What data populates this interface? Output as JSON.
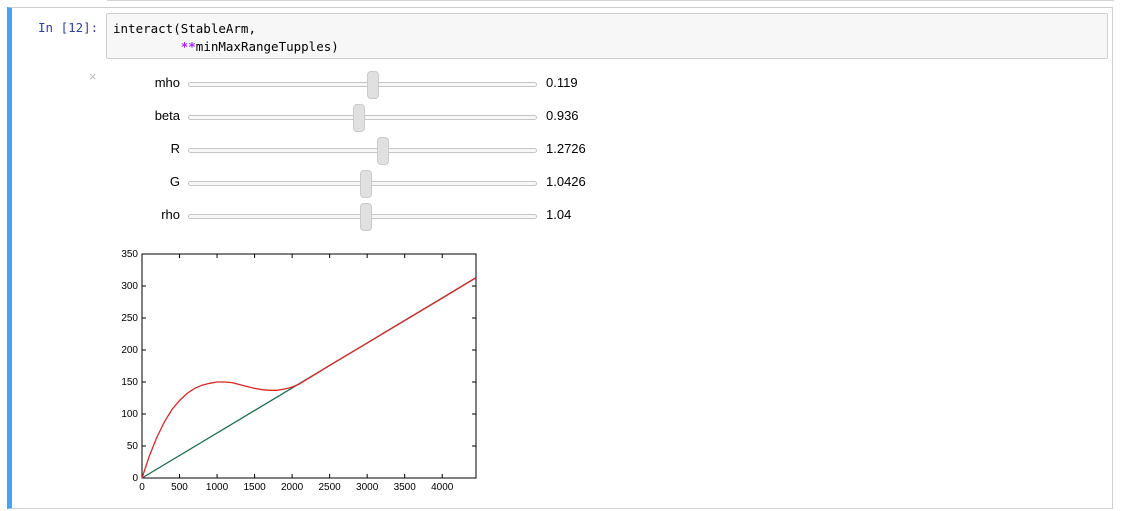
{
  "cell": {
    "prompt": "In [12]:",
    "code_line1": "interact(StableArm,",
    "code_line2_indent": "         ",
    "code_line2_op": "**",
    "code_line2_rest": "minMaxRangeTupples)",
    "close_glyph": "×"
  },
  "sliders": [
    {
      "label": "mho",
      "value_text": "0.119",
      "fraction": 0.53
    },
    {
      "label": "beta",
      "value_text": "0.936",
      "fraction": 0.49
    },
    {
      "label": "R",
      "value_text": "1.2726",
      "fraction": 0.56
    },
    {
      "label": "G",
      "value_text": "1.0426",
      "fraction": 0.51
    },
    {
      "label": "rho",
      "value_text": "1.04",
      "fraction": 0.51
    }
  ],
  "chart_data": {
    "type": "line",
    "xlim": [
      0,
      4450
    ],
    "ylim": [
      0,
      350
    ],
    "xticks": [
      0,
      500,
      1000,
      1500,
      2000,
      2500,
      3000,
      3500,
      4000
    ],
    "yticks": [
      0,
      50,
      100,
      150,
      200,
      250,
      300,
      350
    ],
    "grid": false,
    "colors": {
      "red": "#d62728",
      "green": "#1a6b4a"
    },
    "series": [
      {
        "color": "#1a6b4a",
        "x": [
          0,
          4450
        ],
        "y": [
          0,
          313
        ]
      },
      {
        "color": "#d62728",
        "x": [
          0,
          100,
          200,
          300,
          400,
          500,
          600,
          700,
          800,
          900,
          1000,
          1100,
          1200,
          1300,
          1400,
          1500,
          1600,
          1700,
          1800,
          1900,
          2000,
          2100,
          2500,
          3000,
          3500,
          4000,
          4450
        ],
        "y": [
          0,
          35,
          64,
          88,
          107,
          121,
          132,
          140,
          145,
          148,
          150,
          150,
          149,
          146,
          143,
          140,
          138,
          137,
          137,
          139,
          142,
          147,
          176,
          211,
          246,
          281,
          313
        ]
      }
    ]
  }
}
